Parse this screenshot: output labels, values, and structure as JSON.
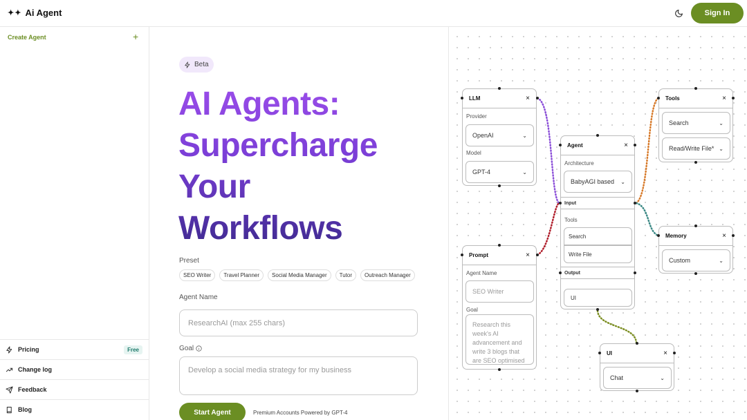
{
  "header": {
    "logo_glyphs": "✦✦",
    "app_name": "Ai Agent",
    "signin_label": "Sign In"
  },
  "sidebar": {
    "create_label": "Create Agent",
    "create_plus": "+",
    "items": [
      {
        "label": "Pricing",
        "badge": "Free"
      },
      {
        "label": "Change log"
      },
      {
        "label": "Feedback"
      },
      {
        "label": "Blog"
      }
    ]
  },
  "main": {
    "beta_label": "Beta",
    "hero_lines": [
      "AI Agents:",
      "Supercharge",
      "Your",
      "Workflows"
    ],
    "preset_label": "Preset",
    "presets": [
      "SEO Writer",
      "Travel Planner",
      "Social Media Manager",
      "Tutor",
      "Outreach Manager"
    ],
    "agent_name_label": "Agent Name",
    "agent_name_placeholder": "ResearchAI (max 255 chars)",
    "goal_label": "Goal",
    "goal_placeholder": "Develop a social media strategy for my business",
    "start_label": "Start Agent",
    "premium_text": "Premium Accounts Powered by GPT-4"
  },
  "canvas": {
    "llm": {
      "title": "LLM",
      "provider_label": "Provider",
      "provider_value": "OpenAI",
      "model_label": "Model",
      "model_value": "GPT-4"
    },
    "prompt": {
      "title": "Prompt",
      "agent_name_label": "Agent Name",
      "agent_name_placeholder": "SEO Writer",
      "goal_label": "Goal",
      "goal_text": "Research this week's AI advancement and write 3 blogs that are SEO optimised"
    },
    "agent": {
      "title": "Agent",
      "architecture_label": "Architecture",
      "architecture_value": "BabyAGI based",
      "input_label": "Input",
      "tools_label": "Tools",
      "tools": [
        "Search",
        "Write File"
      ],
      "output_label": "Output",
      "output_value": "UI"
    },
    "tools": {
      "title": "Tools",
      "items": [
        "Search",
        "Read/Write File*"
      ]
    },
    "memory": {
      "title": "Memory",
      "value": "Custom"
    },
    "ui": {
      "title": "UI",
      "value": "Chat"
    },
    "close_glyph": "×",
    "wire_colors": {
      "llm": "#8a4dd8",
      "prompt": "#b01f2c",
      "tools": "#d77a2a",
      "memory": "#3d8a86",
      "ui": "#7d8f24"
    }
  },
  "colors": {
    "accent": "#6b8e23",
    "hero_gradient_top": "#9b4dea",
    "hero_gradient_bottom": "#3e2a8f",
    "free_badge_bg": "#e6f4f1"
  }
}
